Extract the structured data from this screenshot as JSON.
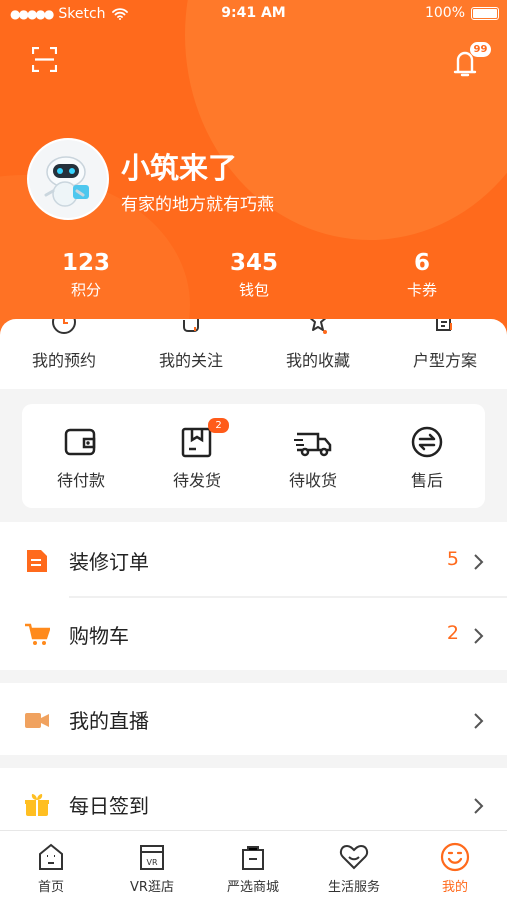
{
  "status_bar": {
    "carrier": "Sketch",
    "time": "9:41 AM",
    "battery_percent": "100%"
  },
  "header": {
    "notification_badge": "99",
    "profile": {
      "name": "小筑来了",
      "slogan": "有家的地方就有巧燕"
    }
  },
  "stats": [
    {
      "value": "123",
      "label": "积分"
    },
    {
      "value": "345",
      "label": "钱包"
    },
    {
      "value": "6",
      "label": "卡券"
    }
  ],
  "quick_links": [
    {
      "label": "我的预约",
      "icon": "clock-icon"
    },
    {
      "label": "我的关注",
      "icon": "follow-icon"
    },
    {
      "label": "我的收藏",
      "icon": "star-icon"
    },
    {
      "label": "户型方案",
      "icon": "floorplan-icon"
    }
  ],
  "orders": {
    "items": [
      {
        "label": "待付款",
        "icon": "wallet-icon"
      },
      {
        "label": "待发货",
        "icon": "package-icon",
        "badge": "2"
      },
      {
        "label": "待收货",
        "icon": "truck-icon"
      },
      {
        "label": "售后",
        "icon": "exchange-icon"
      }
    ]
  },
  "menu": [
    {
      "label": "装修订单",
      "count": "5",
      "icon": "document-icon"
    },
    {
      "label": "购物车",
      "count": "2",
      "icon": "cart-icon"
    },
    {
      "label": "我的直播",
      "count": "",
      "icon": "video-icon"
    },
    {
      "label": "每日签到",
      "count": "",
      "icon": "gift-icon"
    }
  ],
  "tabbar": [
    {
      "label": "首页",
      "icon": "home-icon"
    },
    {
      "label": "VR逛店",
      "icon": "vr-icon"
    },
    {
      "label": "严选商城",
      "icon": "shopping-bag-icon"
    },
    {
      "label": "生活服务",
      "icon": "heart-icon"
    },
    {
      "label": "我的",
      "icon": "smile-icon",
      "active": true
    }
  ],
  "colors": {
    "primary": "#ff6a1c",
    "background": "#f4f4f4",
    "text": "#333333"
  }
}
